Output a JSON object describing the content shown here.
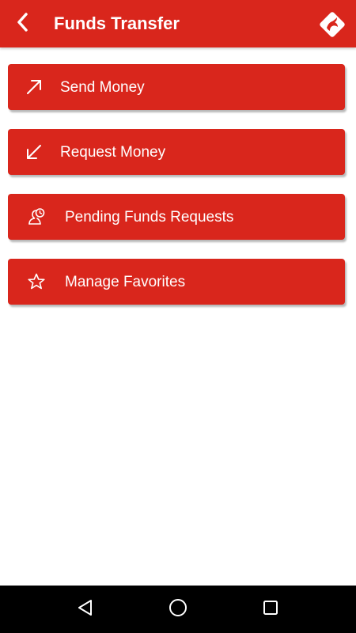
{
  "header": {
    "title": "Funds Transfer",
    "back_icon": "chevron-left-icon",
    "logo_icon": "brand-logo-icon"
  },
  "menu": {
    "items": [
      {
        "label": "Send Money",
        "icon": "arrow-up-right-icon"
      },
      {
        "label": "Request Money",
        "icon": "arrow-down-left-icon"
      },
      {
        "label": "Pending Funds Requests",
        "icon": "pending-request-icon"
      },
      {
        "label": "Manage Favorites",
        "icon": "star-icon"
      }
    ]
  },
  "navbar": {
    "back": "nav-back-icon",
    "home": "nav-home-icon",
    "recents": "nav-recents-icon"
  },
  "colors": {
    "accent": "#d9261c",
    "text_on_accent": "#ffffff",
    "navbar": "#000000"
  }
}
